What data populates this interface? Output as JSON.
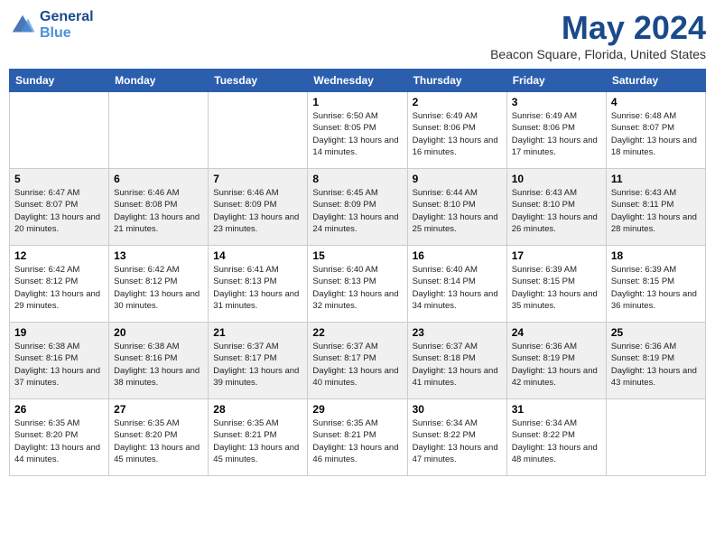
{
  "header": {
    "logo_line1": "General",
    "logo_line2": "Blue",
    "month": "May 2024",
    "location": "Beacon Square, Florida, United States"
  },
  "days_of_week": [
    "Sunday",
    "Monday",
    "Tuesday",
    "Wednesday",
    "Thursday",
    "Friday",
    "Saturday"
  ],
  "weeks": [
    [
      {
        "day": "",
        "sunrise": "",
        "sunset": "",
        "daylight": ""
      },
      {
        "day": "",
        "sunrise": "",
        "sunset": "",
        "daylight": ""
      },
      {
        "day": "",
        "sunrise": "",
        "sunset": "",
        "daylight": ""
      },
      {
        "day": "1",
        "sunrise": "6:50 AM",
        "sunset": "8:05 PM",
        "daylight": "13 hours and 14 minutes."
      },
      {
        "day": "2",
        "sunrise": "6:49 AM",
        "sunset": "8:06 PM",
        "daylight": "13 hours and 16 minutes."
      },
      {
        "day": "3",
        "sunrise": "6:49 AM",
        "sunset": "8:06 PM",
        "daylight": "13 hours and 17 minutes."
      },
      {
        "day": "4",
        "sunrise": "6:48 AM",
        "sunset": "8:07 PM",
        "daylight": "13 hours and 18 minutes."
      }
    ],
    [
      {
        "day": "5",
        "sunrise": "6:47 AM",
        "sunset": "8:07 PM",
        "daylight": "13 hours and 20 minutes."
      },
      {
        "day": "6",
        "sunrise": "6:46 AM",
        "sunset": "8:08 PM",
        "daylight": "13 hours and 21 minutes."
      },
      {
        "day": "7",
        "sunrise": "6:46 AM",
        "sunset": "8:09 PM",
        "daylight": "13 hours and 23 minutes."
      },
      {
        "day": "8",
        "sunrise": "6:45 AM",
        "sunset": "8:09 PM",
        "daylight": "13 hours and 24 minutes."
      },
      {
        "day": "9",
        "sunrise": "6:44 AM",
        "sunset": "8:10 PM",
        "daylight": "13 hours and 25 minutes."
      },
      {
        "day": "10",
        "sunrise": "6:43 AM",
        "sunset": "8:10 PM",
        "daylight": "13 hours and 26 minutes."
      },
      {
        "day": "11",
        "sunrise": "6:43 AM",
        "sunset": "8:11 PM",
        "daylight": "13 hours and 28 minutes."
      }
    ],
    [
      {
        "day": "12",
        "sunrise": "6:42 AM",
        "sunset": "8:12 PM",
        "daylight": "13 hours and 29 minutes."
      },
      {
        "day": "13",
        "sunrise": "6:42 AM",
        "sunset": "8:12 PM",
        "daylight": "13 hours and 30 minutes."
      },
      {
        "day": "14",
        "sunrise": "6:41 AM",
        "sunset": "8:13 PM",
        "daylight": "13 hours and 31 minutes."
      },
      {
        "day": "15",
        "sunrise": "6:40 AM",
        "sunset": "8:13 PM",
        "daylight": "13 hours and 32 minutes."
      },
      {
        "day": "16",
        "sunrise": "6:40 AM",
        "sunset": "8:14 PM",
        "daylight": "13 hours and 34 minutes."
      },
      {
        "day": "17",
        "sunrise": "6:39 AM",
        "sunset": "8:15 PM",
        "daylight": "13 hours and 35 minutes."
      },
      {
        "day": "18",
        "sunrise": "6:39 AM",
        "sunset": "8:15 PM",
        "daylight": "13 hours and 36 minutes."
      }
    ],
    [
      {
        "day": "19",
        "sunrise": "6:38 AM",
        "sunset": "8:16 PM",
        "daylight": "13 hours and 37 minutes."
      },
      {
        "day": "20",
        "sunrise": "6:38 AM",
        "sunset": "8:16 PM",
        "daylight": "13 hours and 38 minutes."
      },
      {
        "day": "21",
        "sunrise": "6:37 AM",
        "sunset": "8:17 PM",
        "daylight": "13 hours and 39 minutes."
      },
      {
        "day": "22",
        "sunrise": "6:37 AM",
        "sunset": "8:17 PM",
        "daylight": "13 hours and 40 minutes."
      },
      {
        "day": "23",
        "sunrise": "6:37 AM",
        "sunset": "8:18 PM",
        "daylight": "13 hours and 41 minutes."
      },
      {
        "day": "24",
        "sunrise": "6:36 AM",
        "sunset": "8:19 PM",
        "daylight": "13 hours and 42 minutes."
      },
      {
        "day": "25",
        "sunrise": "6:36 AM",
        "sunset": "8:19 PM",
        "daylight": "13 hours and 43 minutes."
      }
    ],
    [
      {
        "day": "26",
        "sunrise": "6:35 AM",
        "sunset": "8:20 PM",
        "daylight": "13 hours and 44 minutes."
      },
      {
        "day": "27",
        "sunrise": "6:35 AM",
        "sunset": "8:20 PM",
        "daylight": "13 hours and 45 minutes."
      },
      {
        "day": "28",
        "sunrise": "6:35 AM",
        "sunset": "8:21 PM",
        "daylight": "13 hours and 45 minutes."
      },
      {
        "day": "29",
        "sunrise": "6:35 AM",
        "sunset": "8:21 PM",
        "daylight": "13 hours and 46 minutes."
      },
      {
        "day": "30",
        "sunrise": "6:34 AM",
        "sunset": "8:22 PM",
        "daylight": "13 hours and 47 minutes."
      },
      {
        "day": "31",
        "sunrise": "6:34 AM",
        "sunset": "8:22 PM",
        "daylight": "13 hours and 48 minutes."
      },
      {
        "day": "",
        "sunrise": "",
        "sunset": "",
        "daylight": ""
      }
    ]
  ],
  "labels": {
    "sunrise": "Sunrise:",
    "sunset": "Sunset:",
    "daylight": "Daylight:"
  }
}
